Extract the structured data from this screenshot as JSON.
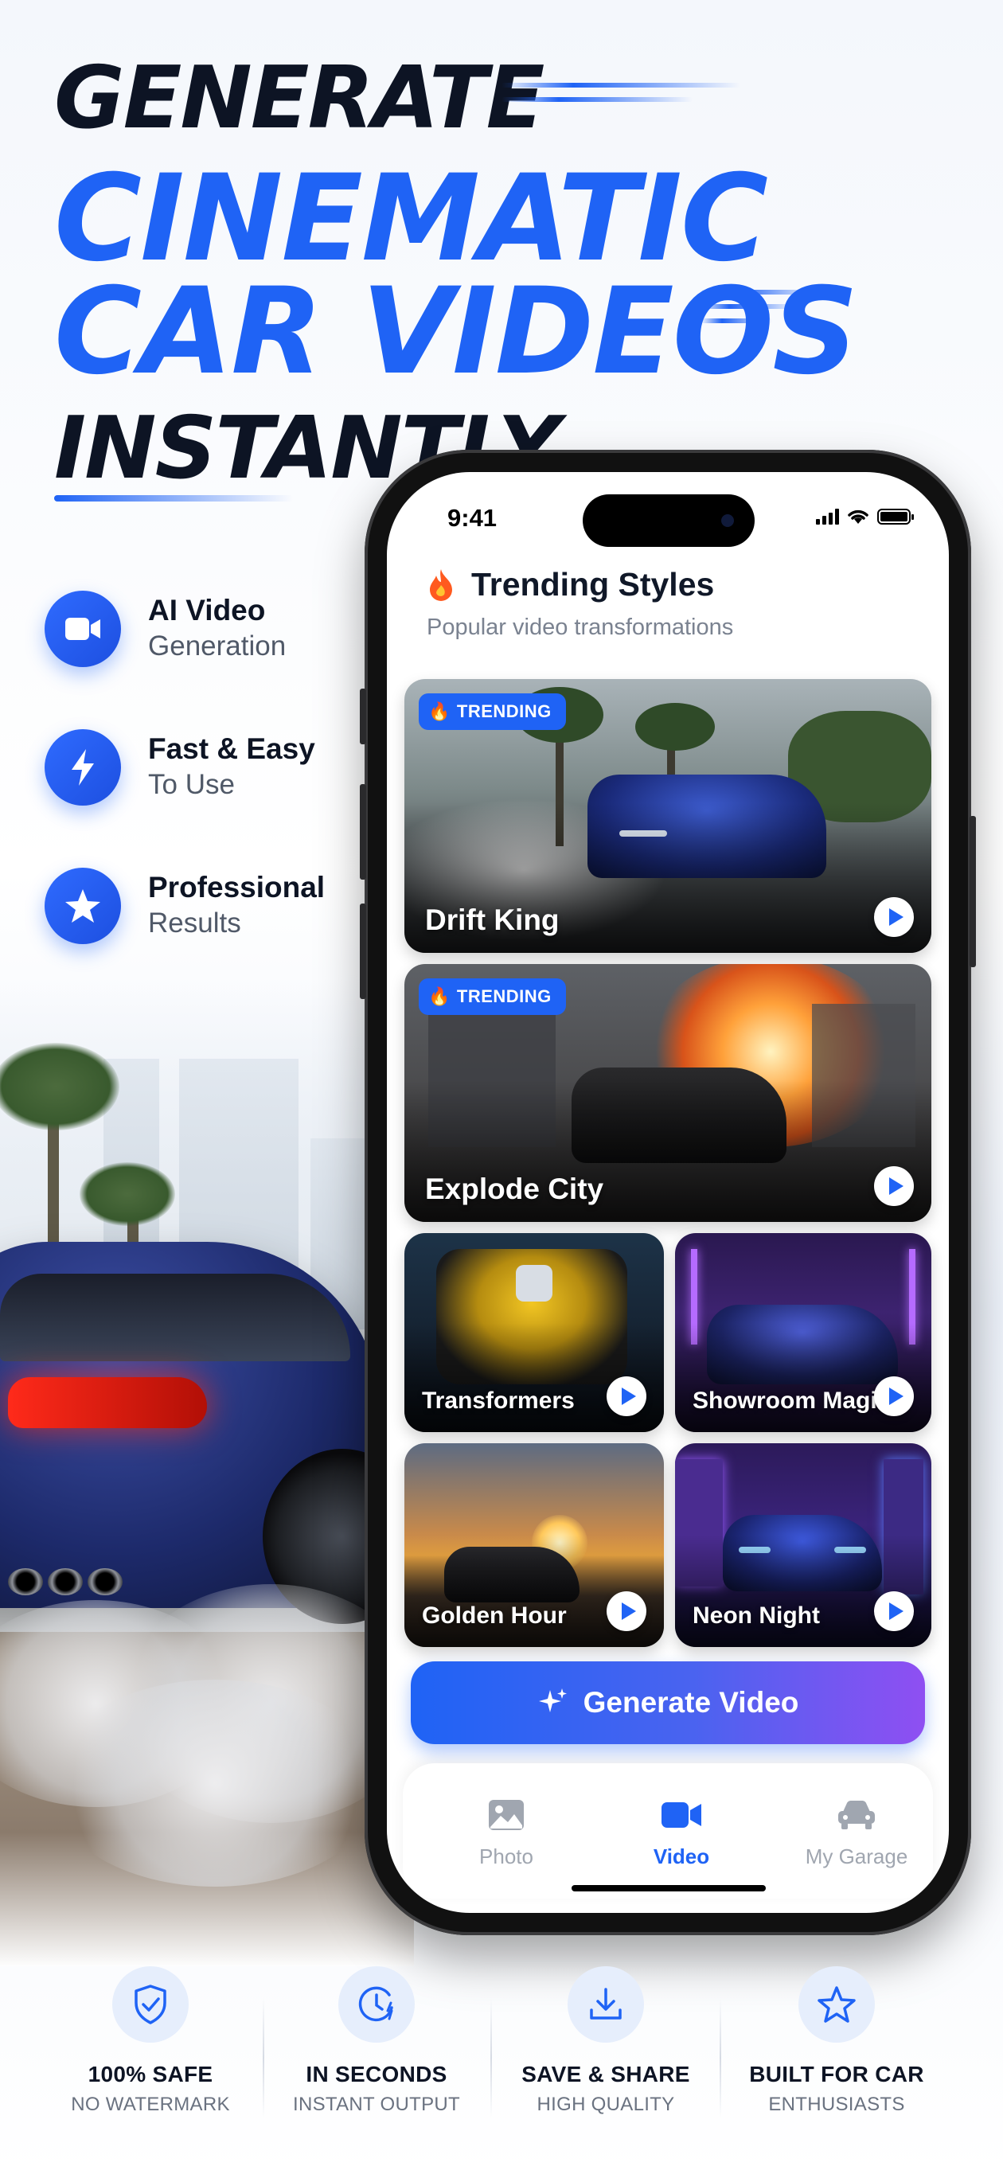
{
  "headline": {
    "line1": "GENERATE",
    "line2": "CINEMATIC",
    "line3": "CAR VIDEOS",
    "line4": "INSTANTLY"
  },
  "features": [
    {
      "title": "AI Video",
      "subtitle": "Generation",
      "icon": "video-camera-icon"
    },
    {
      "title": "Fast & Easy",
      "subtitle": "To Use",
      "icon": "lightning-icon"
    },
    {
      "title": "Professional",
      "subtitle": "Results",
      "icon": "star-icon"
    }
  ],
  "phone": {
    "status": {
      "time": "9:41"
    },
    "section": {
      "icon": "fire-icon",
      "title": "Trending Styles",
      "subtitle": "Popular video transformations"
    },
    "styles": [
      {
        "label": "Drift King",
        "badge": "TRENDING"
      },
      {
        "label": "Explode City",
        "badge": "TRENDING"
      },
      {
        "label": "Transformers"
      },
      {
        "label": "Showroom Magic"
      },
      {
        "label": "Golden Hour"
      },
      {
        "label": "Neon Night"
      }
    ],
    "generate_button": "Generate Video",
    "tabs": [
      {
        "label": "Photo",
        "icon": "image-icon",
        "active": false
      },
      {
        "label": "Video",
        "icon": "video-camera-icon",
        "active": true
      },
      {
        "label": "My Garage",
        "icon": "car-icon",
        "active": false
      }
    ]
  },
  "badges": [
    {
      "title": "100% SAFE",
      "subtitle": "NO WATERMARK",
      "icon": "shield-check-icon"
    },
    {
      "title": "IN SECONDS",
      "subtitle": "INSTANT OUTPUT",
      "icon": "timer-icon"
    },
    {
      "title": "SAVE & SHARE",
      "subtitle": "HIGH QUALITY",
      "icon": "download-icon"
    },
    {
      "title": "BUILT FOR CAR",
      "subtitle": "ENTHUSIASTS",
      "icon": "star-outline-icon"
    }
  ],
  "colors": {
    "accent": "#1f63f5",
    "gradient_end": "#8f4ff2",
    "heading_dark": "#0d1424"
  }
}
